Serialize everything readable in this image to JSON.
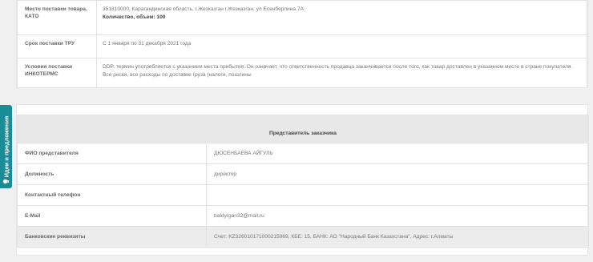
{
  "delivery": {
    "place_label": "Место поставки товара, КАТО",
    "place_value": "351810000, Карагандинская область, г.Жезказган г.Жезказган, ул Есенберлина 7А",
    "quantity": "Количество, объем: 100",
    "period_label": "Срок поставки ТРУ",
    "period_value": "С 1 января по 31 декабря 2021 года",
    "incoterms_label": "Условия поставки ИНКОТЕРМС",
    "incoterms_value": "DDP, термин употребляется с указанием места прибытия. Он означает, что ответственность продавца заканчивается после того, как товар доставлен в указанном месте в стране покупателя. Все риски, все расходы по доставке груза (налоги, пошлины"
  },
  "representative": {
    "header": "Представитель заказчика",
    "rows": [
      {
        "label": "ФИО представителя",
        "value": "ДЮСЕНБАЕВА АЙГУЛЬ"
      },
      {
        "label": "Должность",
        "value": "директор"
      },
      {
        "label": "Контактный телефон",
        "value": ""
      },
      {
        "label": "E-Mail",
        "value": "baldyrgan32@mail.ru"
      },
      {
        "label": "Банковские реквизиты",
        "value": "Счет: KZ326010171000215969, КБЕ: 15, БАНК: АО \"Народный Банк Казахстана\", Адрес: г.Алматы"
      }
    ]
  },
  "feedback_tab": {
    "label": "Идеи и предложения",
    "icon": "lightbulb-icon"
  }
}
